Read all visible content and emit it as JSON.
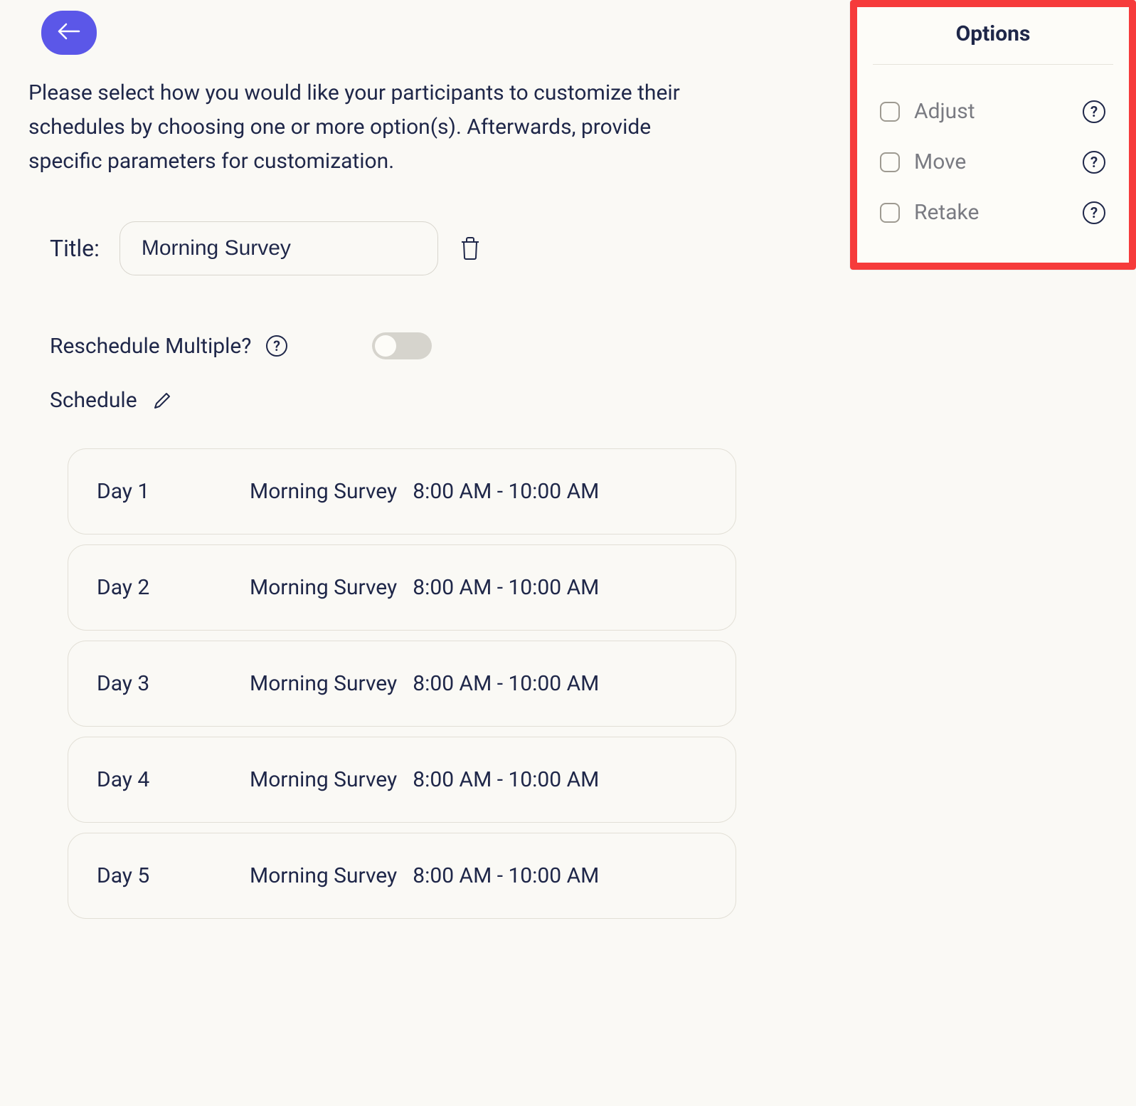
{
  "intro_text": "Please select how you would like your participants to customize their schedules by choosing one or more option(s). Afterwards, provide specific parameters for customization.",
  "title": {
    "label": "Title:",
    "value": "Morning Survey"
  },
  "reschedule": {
    "label": "Reschedule Multiple?",
    "enabled": false
  },
  "schedule": {
    "label": "Schedule",
    "items": [
      {
        "day": "Day 1",
        "name": "Morning Survey",
        "time": "8:00 AM - 10:00 AM"
      },
      {
        "day": "Day 2",
        "name": "Morning Survey",
        "time": "8:00 AM - 10:00 AM"
      },
      {
        "day": "Day 3",
        "name": "Morning Survey",
        "time": "8:00 AM - 10:00 AM"
      },
      {
        "day": "Day 4",
        "name": "Morning Survey",
        "time": "8:00 AM - 10:00 AM"
      },
      {
        "day": "Day 5",
        "name": "Morning Survey",
        "time": "8:00 AM - 10:00 AM"
      }
    ]
  },
  "options": {
    "title": "Options",
    "items": [
      {
        "label": "Adjust",
        "checked": false
      },
      {
        "label": "Move",
        "checked": false
      },
      {
        "label": "Retake",
        "checked": false
      }
    ]
  }
}
